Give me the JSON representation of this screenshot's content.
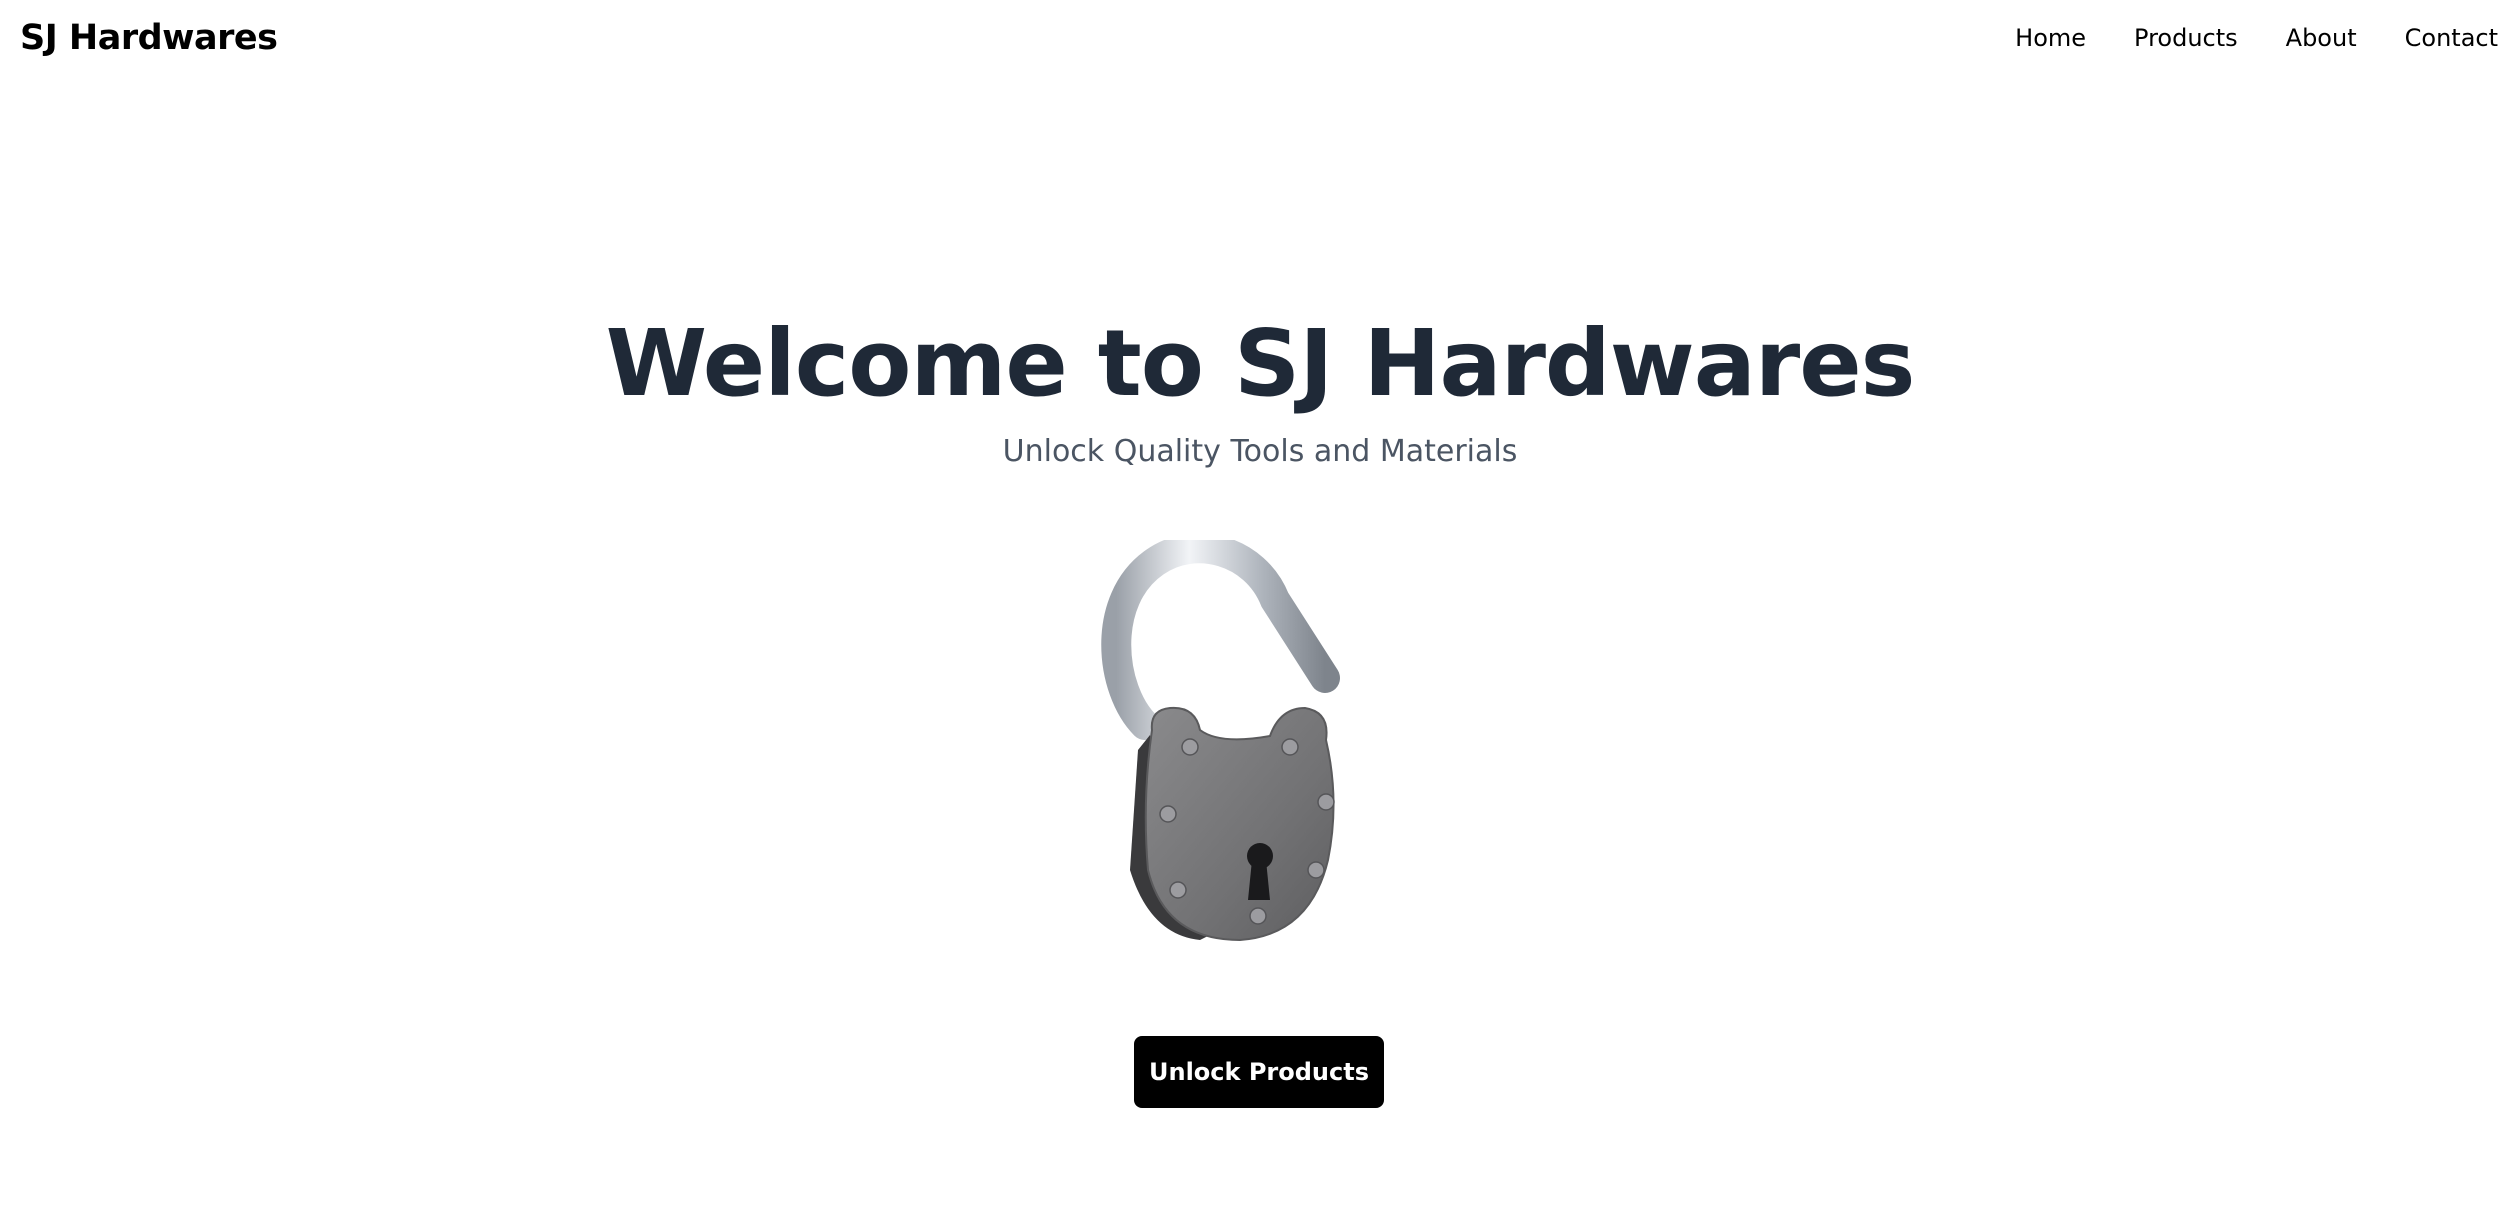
{
  "header": {
    "brand": "SJ Hardwares",
    "nav": [
      "Home",
      "Products",
      "About",
      "Contact"
    ]
  },
  "hero": {
    "title": "Welcome to SJ Hardwares",
    "subtitle": "Unlock Quality Tools and Materials",
    "image_icon": "open-padlock-icon",
    "cta_label": "Unlock Products"
  },
  "colors": {
    "title": "#1f2937",
    "subtitle": "#4b5563",
    "button_bg": "#000000",
    "button_text": "#ffffff",
    "padlock_body": "#7a7a7c",
    "shackle": "#c8ccd2"
  }
}
